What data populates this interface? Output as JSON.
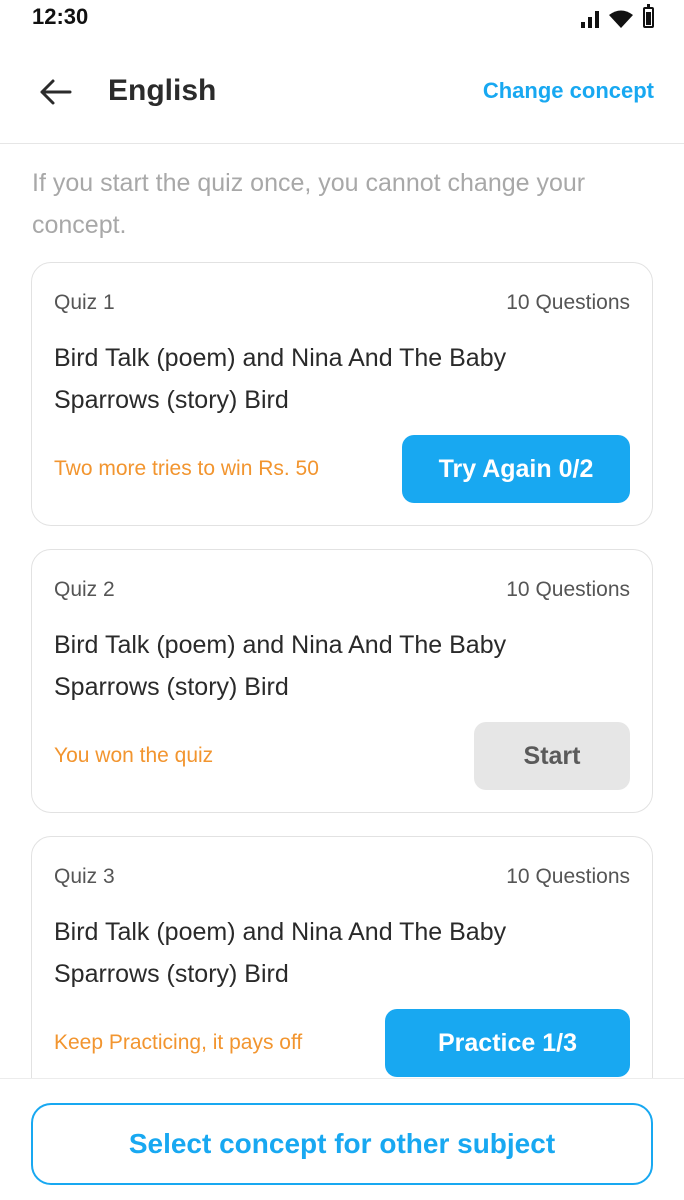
{
  "status_bar": {
    "time": "12:30",
    "icons": [
      "signal-icon",
      "wifi-icon",
      "battery-icon"
    ]
  },
  "header": {
    "back_icon": "arrow-left-icon",
    "title": "English",
    "change_concept_label": "Change concept"
  },
  "notice": "If you start the quiz once, you cannot change your concept.",
  "quizzes": [
    {
      "label": "Quiz 1",
      "question_count": "10 Questions",
      "title": "Bird Talk (poem) and Nina And The Baby Sparrows (story) Bird",
      "status": "Two more tries to win Rs. 50",
      "button_label": "Try Again 0/2",
      "button_style": "primary"
    },
    {
      "label": "Quiz 2",
      "question_count": "10 Questions",
      "title": "Bird Talk (poem) and Nina And The Baby Sparrows (story) Bird",
      "status": "You won the quiz",
      "button_label": "Start",
      "button_style": "disabled"
    },
    {
      "label": "Quiz 3",
      "question_count": "10 Questions",
      "title": "Bird Talk (poem) and Nina And The Baby Sparrows (story) Bird",
      "status": "Keep Practicing, it pays off",
      "button_label": "Practice 1/3",
      "button_style": "primary"
    }
  ],
  "footer": {
    "button_label": "Select concept for other subject"
  },
  "colors": {
    "accent": "#18a8f1",
    "status_text": "#f2952f",
    "muted_text": "#a8a8a8",
    "disabled_button": "#e6e6e6"
  }
}
